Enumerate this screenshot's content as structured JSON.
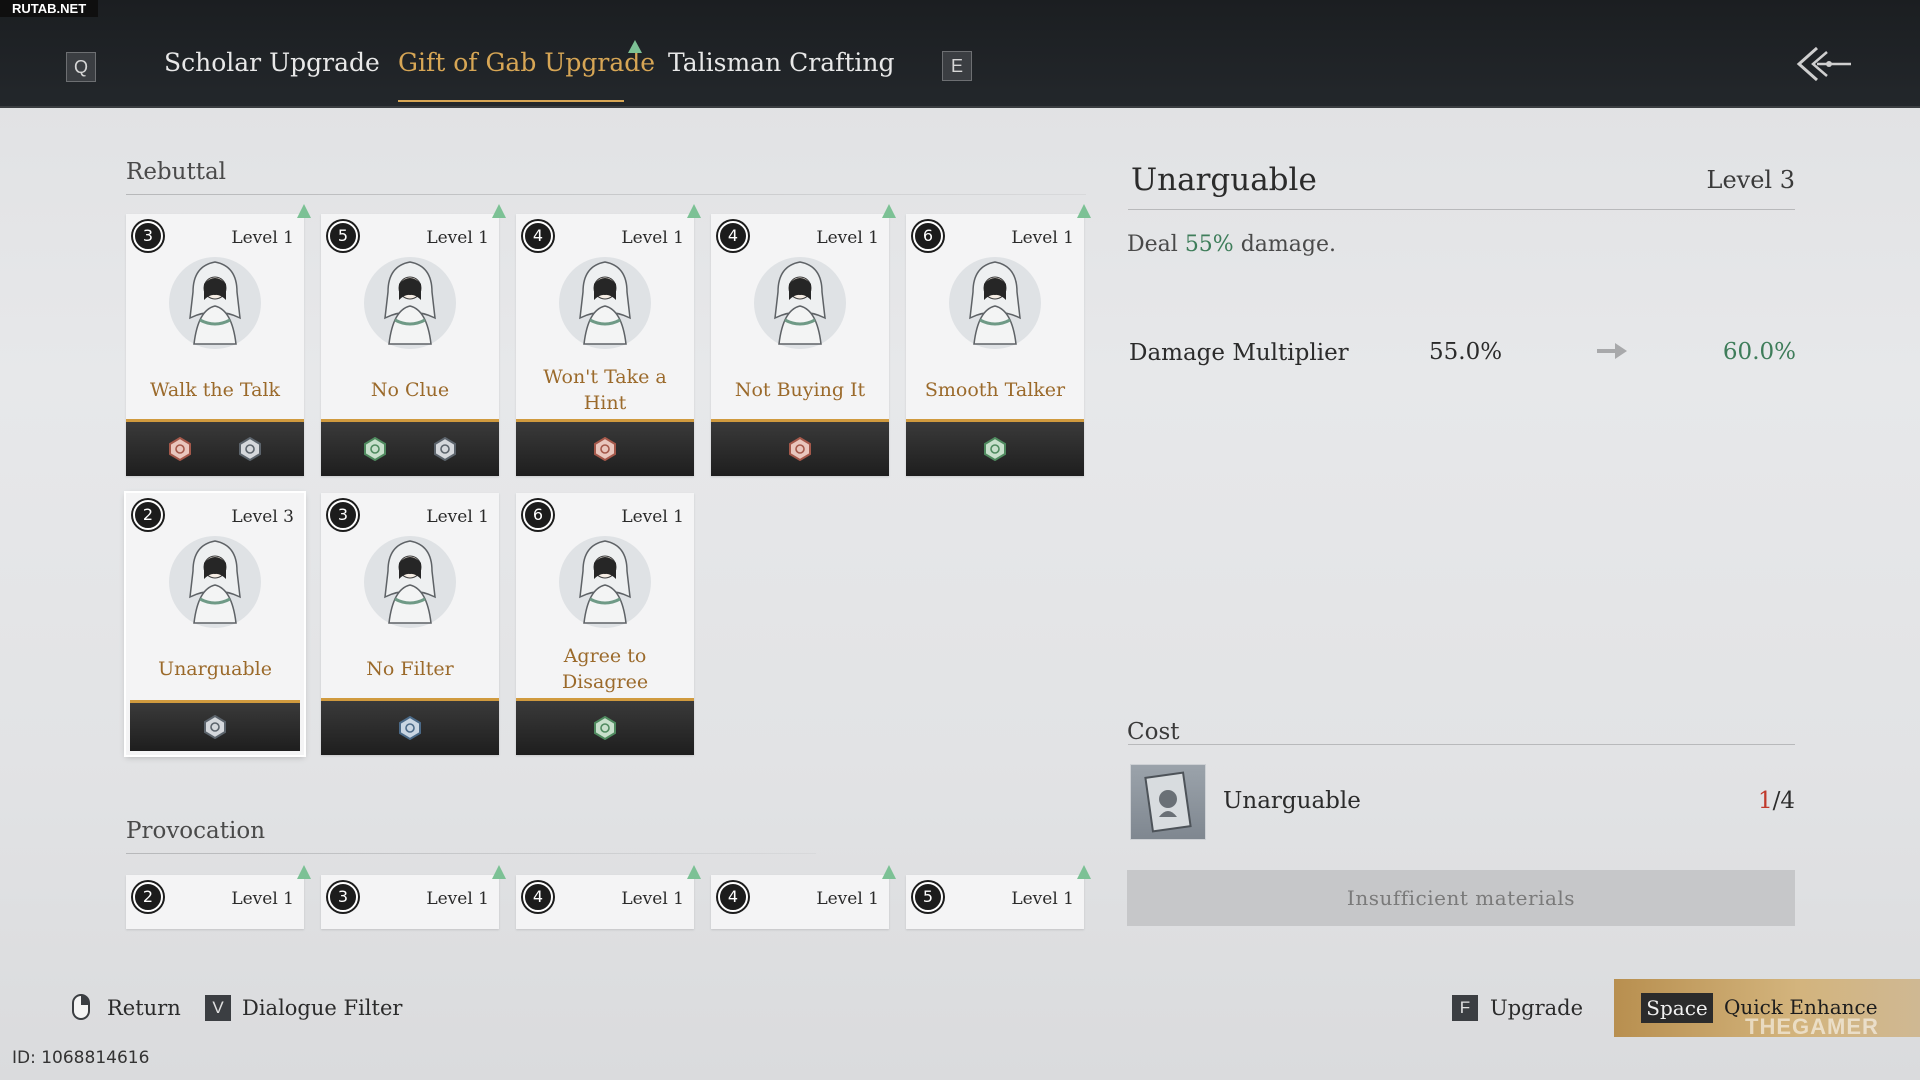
{
  "watermark": "RUTAB.NET",
  "nav": {
    "prev_key": "Q",
    "next_key": "E",
    "tabs": [
      {
        "label": "Scholar Upgrade"
      },
      {
        "label": "Gift of Gab Upgrade"
      },
      {
        "label": "Talisman Crafting"
      }
    ],
    "active_tab": "Gift of Gab Upgrade"
  },
  "sections": {
    "rebuttal": "Rebuttal",
    "provocation": "Provocation"
  },
  "rebuttal_cards": [
    {
      "cost": "3",
      "level": "Level 1",
      "name": "Walk the Talk",
      "tags": [
        "red",
        "grey"
      ]
    },
    {
      "cost": "5",
      "level": "Level 1",
      "name": "No Clue",
      "tags": [
        "green",
        "grey"
      ]
    },
    {
      "cost": "4",
      "level": "Level 1",
      "name": "Won't Take a Hint",
      "tags": [
        "red"
      ]
    },
    {
      "cost": "4",
      "level": "Level 1",
      "name": "Not Buying It",
      "tags": [
        "red"
      ]
    },
    {
      "cost": "6",
      "level": "Level 1",
      "name": "Smooth Talker",
      "tags": [
        "green"
      ]
    },
    {
      "cost": "2",
      "level": "Level 3",
      "name": "Unarguable",
      "tags": [
        "grey"
      ]
    },
    {
      "cost": "3",
      "level": "Level 1",
      "name": "No Filter",
      "tags": [
        "blue"
      ]
    },
    {
      "cost": "6",
      "level": "Level 1",
      "name": "Agree to Disagree",
      "tags": [
        "green"
      ]
    }
  ],
  "provocation_cards": [
    {
      "cost": "2",
      "level": "Level 1"
    },
    {
      "cost": "3",
      "level": "Level 1"
    },
    {
      "cost": "4",
      "level": "Level 1"
    },
    {
      "cost": "4",
      "level": "Level 1"
    },
    {
      "cost": "5",
      "level": "Level 1"
    }
  ],
  "detail": {
    "title": "Unarguable",
    "level": "Level 3",
    "desc_prefix": "Deal ",
    "desc_value": "55%",
    "desc_suffix": " damage.",
    "stat_label": "Damage Multiplier",
    "stat_current": "55.0%",
    "stat_next": "60.0%"
  },
  "cost": {
    "title": "Cost",
    "item_name": "Unarguable",
    "have": "1",
    "need": "/4",
    "button_label": "Insufficient materials"
  },
  "hints": {
    "return_label": "Return",
    "filter_key": "V",
    "filter_label": "Dialogue Filter",
    "upgrade_key": "F",
    "upgrade_label": "Upgrade",
    "quick_key": "Space",
    "quick_label": "Quick Enhance"
  },
  "corner_watermark": "THEGAMER",
  "image_id": "ID: 1068814616",
  "colors": {
    "accent_gold": "#d7a655",
    "card_name": "#9b6a2b",
    "positive": "#3e7d5a",
    "insufficient": "#c0392b",
    "upgrade_indicator": "#7cc195"
  }
}
